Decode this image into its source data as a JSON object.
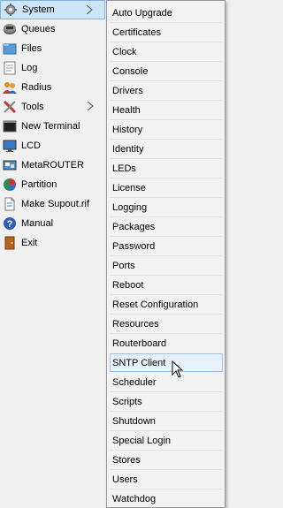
{
  "sidebar": {
    "items": [
      {
        "label": "System",
        "icon": "gear-icon",
        "has_submenu": true,
        "active": true
      },
      {
        "label": "Queues",
        "icon": "queues-icon",
        "has_submenu": false
      },
      {
        "label": "Files",
        "icon": "folder-icon",
        "has_submenu": false
      },
      {
        "label": "Log",
        "icon": "log-icon",
        "has_submenu": false
      },
      {
        "label": "Radius",
        "icon": "users-icon",
        "has_submenu": false
      },
      {
        "label": "Tools",
        "icon": "tools-icon",
        "has_submenu": true
      },
      {
        "label": "New Terminal",
        "icon": "terminal-icon",
        "has_submenu": false
      },
      {
        "label": "LCD",
        "icon": "monitor-icon",
        "has_submenu": false
      },
      {
        "label": "MetaROUTER",
        "icon": "metarouter-icon",
        "has_submenu": false
      },
      {
        "label": "Partition",
        "icon": "pie-icon",
        "has_submenu": false
      },
      {
        "label": "Make Supout.rif",
        "icon": "document-icon",
        "has_submenu": false
      },
      {
        "label": "Manual",
        "icon": "help-icon",
        "has_submenu": false
      },
      {
        "label": "Exit",
        "icon": "exit-icon",
        "has_submenu": false
      }
    ]
  },
  "submenu": {
    "items": [
      {
        "label": "Auto Upgrade"
      },
      {
        "label": "Certificates"
      },
      {
        "label": "Clock"
      },
      {
        "label": "Console"
      },
      {
        "label": "Drivers"
      },
      {
        "label": "Health"
      },
      {
        "label": "History"
      },
      {
        "label": "Identity"
      },
      {
        "label": "LEDs"
      },
      {
        "label": "License"
      },
      {
        "label": "Logging"
      },
      {
        "label": "Packages"
      },
      {
        "label": "Password"
      },
      {
        "label": "Ports"
      },
      {
        "label": "Reboot"
      },
      {
        "label": "Reset Configuration"
      },
      {
        "label": "Resources"
      },
      {
        "label": "Routerboard"
      },
      {
        "label": "SNTP Client",
        "hover": true
      },
      {
        "label": "Scheduler"
      },
      {
        "label": "Scripts"
      },
      {
        "label": "Shutdown"
      },
      {
        "label": "Special Login"
      },
      {
        "label": "Stores"
      },
      {
        "label": "Users"
      },
      {
        "label": "Watchdog"
      }
    ]
  },
  "colors": {
    "active_bg": "#cde6f7",
    "hover_bg": "#e8f1fa"
  }
}
